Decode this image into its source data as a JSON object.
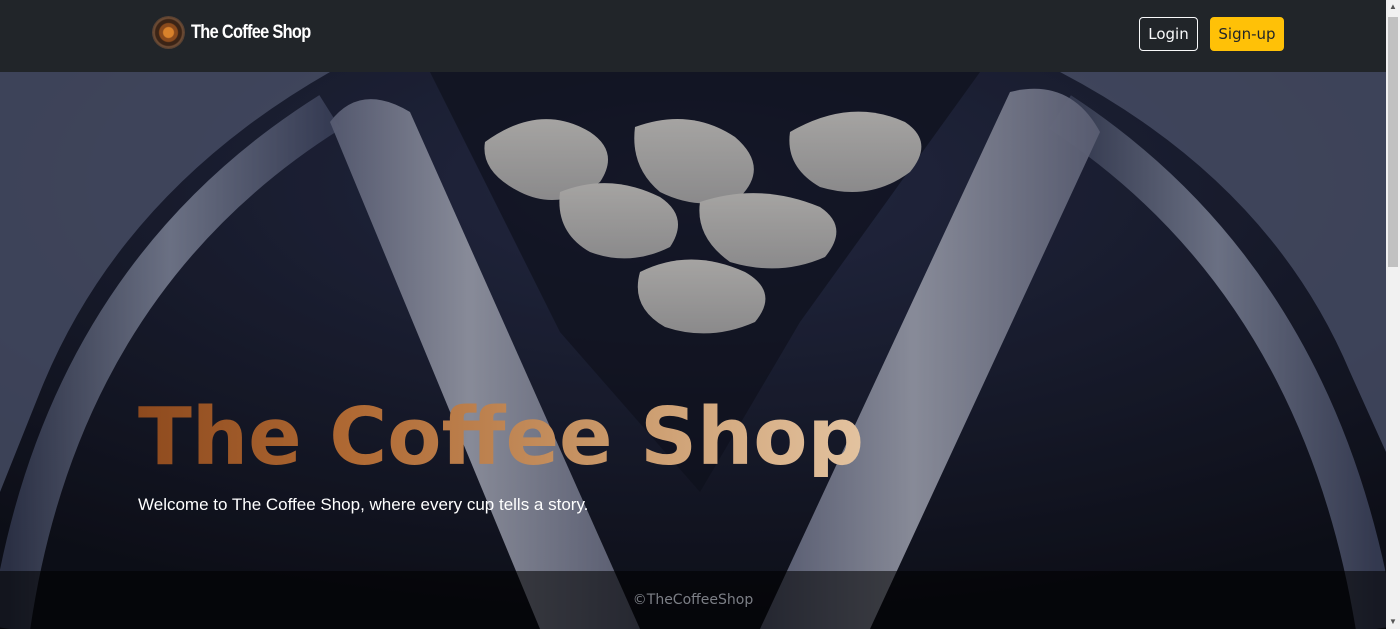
{
  "navbar": {
    "brand_name": "The Coffee Shop",
    "login_label": "Login",
    "signup_label": "Sign-up"
  },
  "hero": {
    "title": "The Coffee Shop",
    "subtitle": "Welcome to The Coffee Shop, where every cup tells a story."
  },
  "footer": {
    "copyright": "©TheCoffeeShop"
  },
  "colors": {
    "navbar_bg": "#212529",
    "signup_bg": "#ffc107",
    "title_gradient_start": "#8e4a1e",
    "title_gradient_end": "#e3c3a0"
  },
  "icons": {
    "logo": "coffee-cup-logo-icon",
    "scroll_up": "scroll-up-arrow-icon",
    "scroll_down": "scroll-down-arrow-icon"
  }
}
